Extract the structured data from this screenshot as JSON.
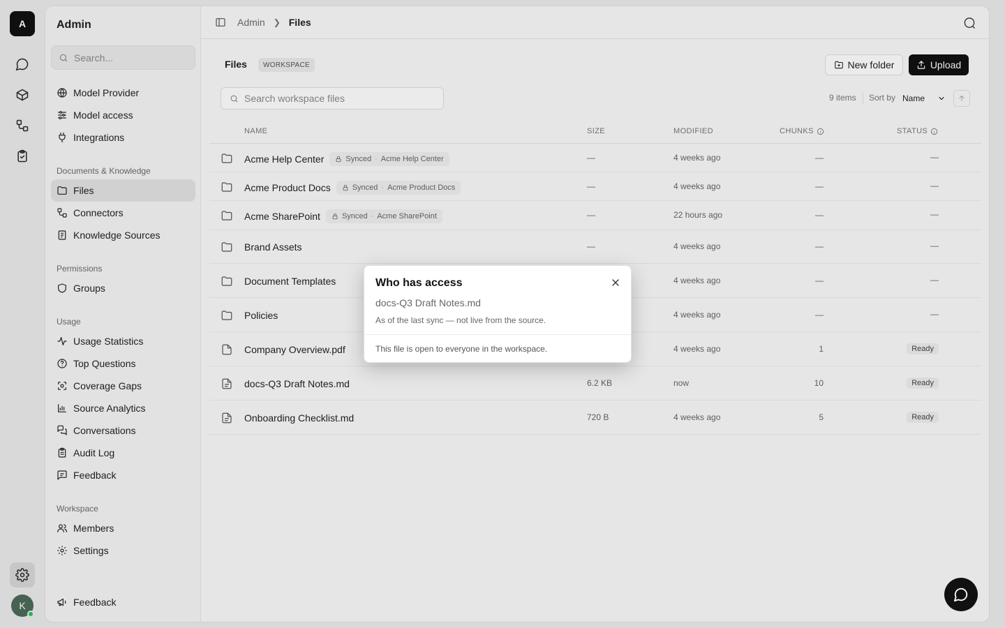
{
  "rail": {
    "logo_letter": "A",
    "avatar_letter": "K",
    "icons": [
      "chat-icon",
      "cube-icon",
      "connectors-icon",
      "clipboard-check-icon",
      "gear-icon"
    ]
  },
  "sidebar": {
    "title": "Admin",
    "search_placeholder": "Search...",
    "items_top": [
      {
        "label": "Model Provider",
        "icon": "globe-icon"
      },
      {
        "label": "Model access",
        "icon": "sliders-icon"
      },
      {
        "label": "Integrations",
        "icon": "plug-icon"
      }
    ],
    "sections": [
      {
        "title": "Documents & Knowledge",
        "items": [
          {
            "label": "Files",
            "icon": "folder-icon",
            "active": true
          },
          {
            "label": "Connectors",
            "icon": "connectors-icon"
          },
          {
            "label": "Knowledge Sources",
            "icon": "book-icon"
          }
        ]
      },
      {
        "title": "Permissions",
        "items": [
          {
            "label": "Groups",
            "icon": "shield-icon"
          }
        ]
      },
      {
        "title": "Usage",
        "items": [
          {
            "label": "Usage Statistics",
            "icon": "activity-icon"
          },
          {
            "label": "Top Questions",
            "icon": "help-circle-icon"
          },
          {
            "label": "Coverage Gaps",
            "icon": "scan-icon"
          },
          {
            "label": "Source Analytics",
            "icon": "bar-chart-icon"
          },
          {
            "label": "Conversations",
            "icon": "messages-icon"
          },
          {
            "label": "Audit Log",
            "icon": "clipboard-list-icon"
          },
          {
            "label": "Feedback",
            "icon": "message-square-icon"
          }
        ]
      },
      {
        "title": "Workspace",
        "items": [
          {
            "label": "Members",
            "icon": "users-icon"
          },
          {
            "label": "Settings",
            "icon": "settings-icon"
          }
        ]
      }
    ],
    "footer_item": {
      "label": "Feedback",
      "icon": "megaphone-icon"
    }
  },
  "topbar": {
    "crumb_root": "Admin",
    "crumb_current": "Files"
  },
  "page": {
    "title": "Files",
    "badge": "WORKSPACE",
    "new_folder_label": "New folder",
    "upload_label": "Upload",
    "search_placeholder": "Search workspace files",
    "items_count": "9 items",
    "sort_label": "Sort by",
    "sort_value": "Name"
  },
  "table": {
    "headers": {
      "name": "NAME",
      "size": "SIZE",
      "modified": "MODIFIED",
      "chunks": "CHUNKS",
      "status": "STATUS"
    },
    "rows": [
      {
        "type": "folder",
        "name": "Acme Help Center",
        "synced": true,
        "sync_label": "Synced",
        "sync_source": "Acme Help Center",
        "size": "—",
        "modified": "4 weeks ago",
        "chunks": "—",
        "status": "—"
      },
      {
        "type": "folder",
        "name": "Acme Product Docs",
        "synced": true,
        "sync_label": "Synced",
        "sync_source": "Acme Product Docs",
        "size": "—",
        "modified": "4 weeks ago",
        "chunks": "—",
        "status": "—"
      },
      {
        "type": "folder",
        "name": "Acme SharePoint",
        "synced": true,
        "sync_label": "Synced",
        "sync_source": "Acme SharePoint",
        "size": "—",
        "modified": "22 hours ago",
        "chunks": "—",
        "status": "—"
      },
      {
        "type": "folder",
        "name": "Brand Assets",
        "synced": false,
        "size": "—",
        "modified": "4 weeks ago",
        "chunks": "—",
        "status": "—"
      },
      {
        "type": "folder",
        "name": "Document Templates",
        "synced": false,
        "size": "",
        "modified": "4 weeks ago",
        "chunks": "—",
        "status": "—"
      },
      {
        "type": "folder",
        "name": "Policies",
        "synced": false,
        "size": "",
        "modified": "4 weeks ago",
        "chunks": "—",
        "status": "—"
      },
      {
        "type": "file",
        "name": "Company Overview.pdf",
        "synced": false,
        "size": "",
        "modified": "4 weeks ago",
        "chunks": "1",
        "status": "Ready"
      },
      {
        "type": "file-text",
        "name": "docs-Q3 Draft Notes.md",
        "synced": false,
        "size": "6.2 KB",
        "modified": "now",
        "chunks": "10",
        "status": "Ready"
      },
      {
        "type": "file-text",
        "name": "Onboarding Checklist.md",
        "synced": false,
        "size": "720 B",
        "modified": "4 weeks ago",
        "chunks": "5",
        "status": "Ready"
      }
    ]
  },
  "dialog": {
    "title": "Who has access",
    "file": "docs-Q3 Draft Notes.md",
    "note": "As of the last sync — not live from the source.",
    "body": "This file is open to everyone in the workspace."
  }
}
